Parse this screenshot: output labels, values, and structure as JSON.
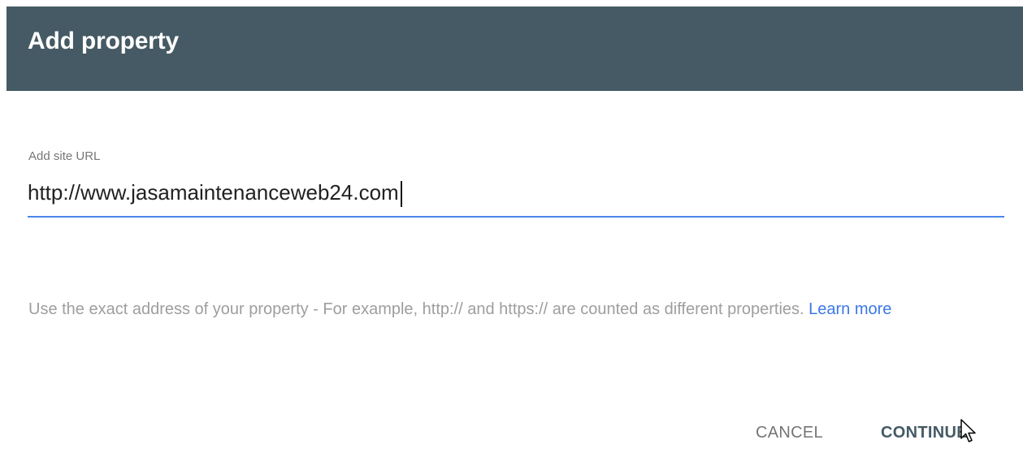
{
  "dialog": {
    "title": "Add property"
  },
  "field": {
    "label": "Add site URL",
    "value": "http://www.jasamaintenanceweb24.com"
  },
  "helper": {
    "text": "Use the exact address of your property - For example, http:// and https:// are counted as different properties. ",
    "link": "Learn more"
  },
  "actions": {
    "cancel": "CANCEL",
    "continue": "CONTINUE"
  },
  "colors": {
    "header_bg": "#455a64",
    "accent": "#4a86e8",
    "link": "#3b78e7"
  },
  "icons": {
    "pointer": "mouse-pointer-icon"
  }
}
